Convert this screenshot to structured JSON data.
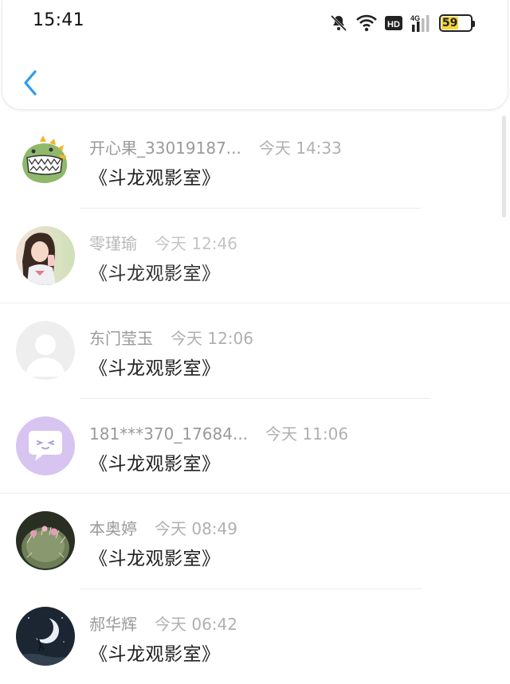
{
  "status_bar": {
    "time": "15:41",
    "network": "4G",
    "hd": "HD",
    "battery": "59",
    "battery_level": 0.59,
    "icons": [
      "bell-muted-icon",
      "wifi-icon",
      "hd-icon",
      "cellular-4g-icon",
      "battery-icon"
    ]
  },
  "header": {
    "back_icon": "chevron-left-icon",
    "accent_color": "#2d9bf0"
  },
  "items": [
    {
      "name": "开心果_33019187...",
      "time": "今天 14:33",
      "title": "《斗龙观影室》",
      "avatar": "dinosaur-avatar"
    },
    {
      "name": "零瑾瑜",
      "time": "今天 12:46",
      "title": "《斗龙观影室》",
      "avatar": "girl-photo-avatar"
    },
    {
      "name": "东门莹玉",
      "time": "今天 12:06",
      "title": "《斗龙观影室》",
      "avatar": "default-user-avatar"
    },
    {
      "name": "181***370_17684...",
      "time": "今天 11:06",
      "title": "《斗龙观影室》",
      "avatar": "chat-bubble-avatar"
    },
    {
      "name": "本奥婷",
      "time": "今天 08:49",
      "title": "《斗龙观影室》",
      "avatar": "cactus-photo-avatar"
    },
    {
      "name": "郝华辉",
      "time": "今天 06:42",
      "title": "《斗龙观影室》",
      "avatar": "moon-night-avatar"
    }
  ]
}
